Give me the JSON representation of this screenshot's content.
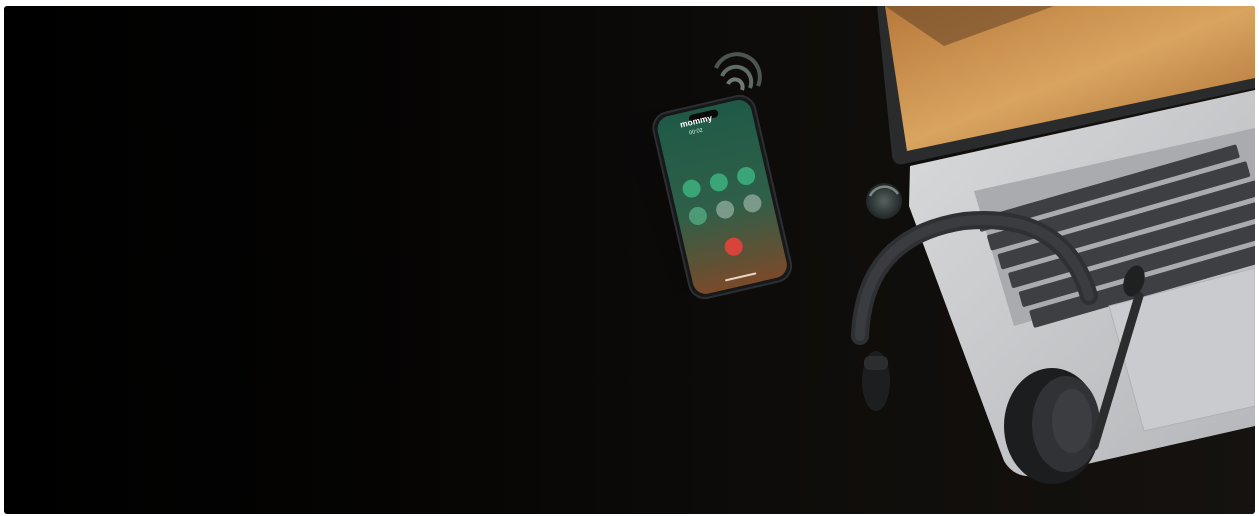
{
  "scene": {
    "description_alt": "",
    "phone": {
      "caller_name": "mommy",
      "call_timer": "00:02"
    },
    "colors": {
      "background": "#0d0b09",
      "phone_screen_top": "#1f5a47",
      "phone_screen_bottom": "#7a4a2a",
      "call_button": "#3aa577",
      "end_call_button": "#d9443a",
      "laptop_body": "#c7c9cc",
      "keyboard_key": "#3d3f42",
      "headset": "#2e3033",
      "desert_sky": "#6b4a2a",
      "desert_dune": "#d19a55"
    }
  }
}
